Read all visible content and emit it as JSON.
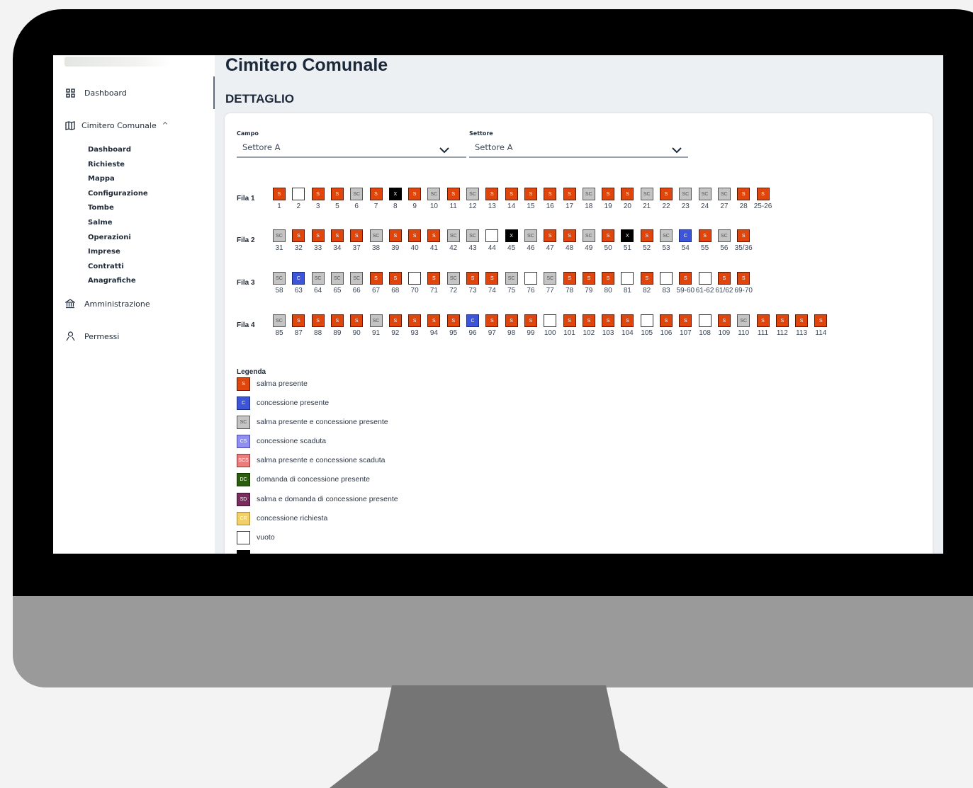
{
  "sidebar": {
    "dashboard": "Dashboard",
    "cimitero": "Cimitero Comunale",
    "caret": "^",
    "sub_items": [
      "Dashboard",
      "Richieste",
      "Mappa",
      "Configurazione",
      "Tombe",
      "Salme",
      "Operazioni",
      "Imprese",
      "Contratti",
      "Anagrafiche"
    ],
    "amministrazione": "Amministrazione",
    "permessi": "Permessi"
  },
  "header": {
    "title": "Cimitero Comunale",
    "section": "DETTAGLIO"
  },
  "filters": {
    "campo": {
      "label": "Campo",
      "value": "Settore A"
    },
    "settore": {
      "label": "Settore",
      "value": "Settore A"
    }
  },
  "rows": [
    {
      "label": "Fila 1",
      "tombs": [
        {
          "n": "1",
          "s": "S"
        },
        {
          "n": "2",
          "s": "E"
        },
        {
          "n": "3",
          "s": "S"
        },
        {
          "n": "5",
          "s": "S"
        },
        {
          "n": "6",
          "s": "SC"
        },
        {
          "n": "7",
          "s": "S"
        },
        {
          "n": "8",
          "s": "X"
        },
        {
          "n": "9",
          "s": "S"
        },
        {
          "n": "10",
          "s": "SC"
        },
        {
          "n": "11",
          "s": "S"
        },
        {
          "n": "12",
          "s": "SC"
        },
        {
          "n": "13",
          "s": "S"
        },
        {
          "n": "14",
          "s": "S"
        },
        {
          "n": "15",
          "s": "S"
        },
        {
          "n": "16",
          "s": "S"
        },
        {
          "n": "17",
          "s": "S"
        },
        {
          "n": "18",
          "s": "SC"
        },
        {
          "n": "19",
          "s": "S"
        },
        {
          "n": "20",
          "s": "S"
        },
        {
          "n": "21",
          "s": "SC"
        },
        {
          "n": "22",
          "s": "S"
        },
        {
          "n": "23",
          "s": "SC"
        },
        {
          "n": "24",
          "s": "SC"
        },
        {
          "n": "27",
          "s": "SC"
        },
        {
          "n": "28",
          "s": "S"
        },
        {
          "n": "25-26",
          "s": "S"
        }
      ]
    },
    {
      "label": "Fila 2",
      "tombs": [
        {
          "n": "31",
          "s": "SC"
        },
        {
          "n": "32",
          "s": "S"
        },
        {
          "n": "33",
          "s": "S"
        },
        {
          "n": "34",
          "s": "S"
        },
        {
          "n": "37",
          "s": "S"
        },
        {
          "n": "38",
          "s": "SC"
        },
        {
          "n": "39",
          "s": "S"
        },
        {
          "n": "40",
          "s": "S"
        },
        {
          "n": "41",
          "s": "S"
        },
        {
          "n": "42",
          "s": "SC"
        },
        {
          "n": "43",
          "s": "SC"
        },
        {
          "n": "44",
          "s": "E"
        },
        {
          "n": "45",
          "s": "X"
        },
        {
          "n": "46",
          "s": "SC"
        },
        {
          "n": "47",
          "s": "S"
        },
        {
          "n": "48",
          "s": "S"
        },
        {
          "n": "49",
          "s": "SC"
        },
        {
          "n": "50",
          "s": "S"
        },
        {
          "n": "51",
          "s": "X"
        },
        {
          "n": "52",
          "s": "S"
        },
        {
          "n": "53",
          "s": "SC"
        },
        {
          "n": "54",
          "s": "C"
        },
        {
          "n": "55",
          "s": "S"
        },
        {
          "n": "56",
          "s": "SC"
        },
        {
          "n": "35/36",
          "s": "S"
        }
      ]
    },
    {
      "label": "Fila 3",
      "tombs": [
        {
          "n": "58",
          "s": "SC"
        },
        {
          "n": "63",
          "s": "C"
        },
        {
          "n": "64",
          "s": "SC"
        },
        {
          "n": "65",
          "s": "SC"
        },
        {
          "n": "66",
          "s": "SC"
        },
        {
          "n": "67",
          "s": "S"
        },
        {
          "n": "68",
          "s": "S"
        },
        {
          "n": "70",
          "s": "E"
        },
        {
          "n": "71",
          "s": "S"
        },
        {
          "n": "72",
          "s": "SC"
        },
        {
          "n": "73",
          "s": "S"
        },
        {
          "n": "74",
          "s": "S"
        },
        {
          "n": "75",
          "s": "SC"
        },
        {
          "n": "76",
          "s": "E"
        },
        {
          "n": "77",
          "s": "SC"
        },
        {
          "n": "78",
          "s": "S"
        },
        {
          "n": "79",
          "s": "S"
        },
        {
          "n": "80",
          "s": "S"
        },
        {
          "n": "81",
          "s": "E"
        },
        {
          "n": "82",
          "s": "S"
        },
        {
          "n": "83",
          "s": "E"
        },
        {
          "n": "59-60",
          "s": "S"
        },
        {
          "n": "61-62",
          "s": "E"
        },
        {
          "n": "61/62",
          "s": "S"
        },
        {
          "n": "69-70",
          "s": "S"
        }
      ]
    },
    {
      "label": "Fila 4",
      "tombs": [
        {
          "n": "85",
          "s": "SC"
        },
        {
          "n": "87",
          "s": "S"
        },
        {
          "n": "88",
          "s": "S"
        },
        {
          "n": "89",
          "s": "S"
        },
        {
          "n": "90",
          "s": "S"
        },
        {
          "n": "91",
          "s": "SC"
        },
        {
          "n": "92",
          "s": "S"
        },
        {
          "n": "93",
          "s": "S"
        },
        {
          "n": "94",
          "s": "S"
        },
        {
          "n": "95",
          "s": "S"
        },
        {
          "n": "96",
          "s": "C"
        },
        {
          "n": "97",
          "s": "S"
        },
        {
          "n": "98",
          "s": "S"
        },
        {
          "n": "99",
          "s": "S"
        },
        {
          "n": "100",
          "s": "E"
        },
        {
          "n": "101",
          "s": "S"
        },
        {
          "n": "102",
          "s": "S"
        },
        {
          "n": "103",
          "s": "S"
        },
        {
          "n": "104",
          "s": "S"
        },
        {
          "n": "105",
          "s": "E"
        },
        {
          "n": "106",
          "s": "S"
        },
        {
          "n": "107",
          "s": "S"
        },
        {
          "n": "108",
          "s": "E"
        },
        {
          "n": "109",
          "s": "S"
        },
        {
          "n": "110",
          "s": "SC"
        },
        {
          "n": "111",
          "s": "S"
        },
        {
          "n": "112",
          "s": "S"
        },
        {
          "n": "113",
          "s": "S"
        },
        {
          "n": "114",
          "s": "S"
        }
      ]
    }
  ],
  "status_codes": {
    "S": "S",
    "SC": "SC",
    "C": "C",
    "X": "X",
    "E": "",
    "CS": "CS",
    "SCS": "SCS",
    "DC": "DC",
    "SD": "SD",
    "CR": "CR"
  },
  "legend": {
    "title": "Legenda",
    "items": [
      {
        "code": "S",
        "text": "salma presente"
      },
      {
        "code": "C",
        "text": "concessione presente"
      },
      {
        "code": "SC",
        "text": "salma presente e concessione presente"
      },
      {
        "code": "CS",
        "text": "concessione scaduta"
      },
      {
        "code": "SCS",
        "text": "salma presente e concessione scaduta"
      },
      {
        "code": "DC",
        "text": "domanda di concessione presente"
      },
      {
        "code": "SD",
        "text": "salma e domanda di concessione presente"
      },
      {
        "code": "CR",
        "text": "concessione richiesta"
      },
      {
        "code": "E",
        "text": "vuoto"
      },
      {
        "code": "X",
        "text": ""
      }
    ]
  },
  "colors": {
    "salma": "#e0450c",
    "concessione": "#3d55d8",
    "salma_concessione": "#c4c4c4",
    "concessione_scaduta": "#8e8ef4",
    "salma_scaduta": "#ea7c7c",
    "domanda": "#2b5e0c",
    "salma_domanda": "#7a2c5e",
    "richiesta": "#f2cf67",
    "vuoto": "#ffffff",
    "occupato": "#000000"
  }
}
